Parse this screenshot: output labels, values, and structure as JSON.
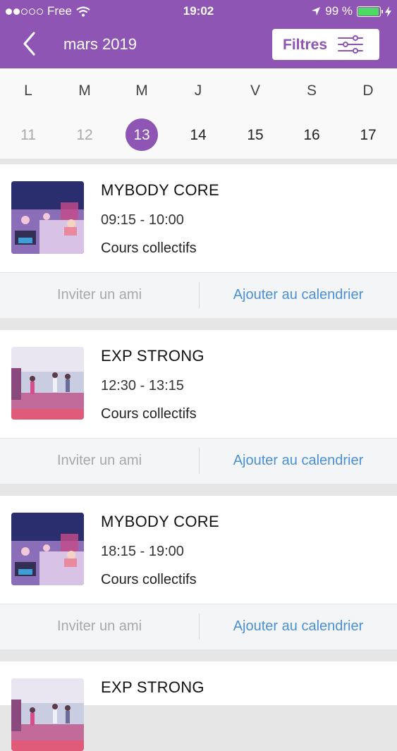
{
  "status_bar": {
    "carrier": "Free",
    "time": "19:02",
    "battery": "99 %",
    "battery_level": 0.99
  },
  "nav": {
    "title": "mars 2019",
    "filter_label": "Filtres",
    "back_icon": "chevron-left-icon",
    "filter_icon": "sliders-icon"
  },
  "week": {
    "day_names": [
      "L",
      "M",
      "M",
      "J",
      "V",
      "S",
      "D"
    ],
    "day_numbers": [
      "11",
      "12",
      "13",
      "14",
      "15",
      "16",
      "17"
    ],
    "selected_index": 2
  },
  "classes": [
    {
      "title": "MYBODY CORE",
      "time": "09:15 - 10:00",
      "type": "Cours collectifs",
      "invite": "Inviter un ami",
      "add_calendar": "Ajouter au calendrier"
    },
    {
      "title": "EXP STRONG",
      "time": "12:30 - 13:15",
      "type": "Cours collectifs",
      "invite": "Inviter un ami",
      "add_calendar": "Ajouter au calendrier"
    },
    {
      "title": "MYBODY CORE",
      "time": "18:15 - 19:00",
      "type": "Cours collectifs",
      "invite": "Inviter un ami",
      "add_calendar": "Ajouter au calendrier"
    },
    {
      "title": "EXP STRONG"
    }
  ],
  "colors": {
    "brand": "#8f55b4",
    "link": "#4a90d9",
    "battery": "#4cd964"
  }
}
